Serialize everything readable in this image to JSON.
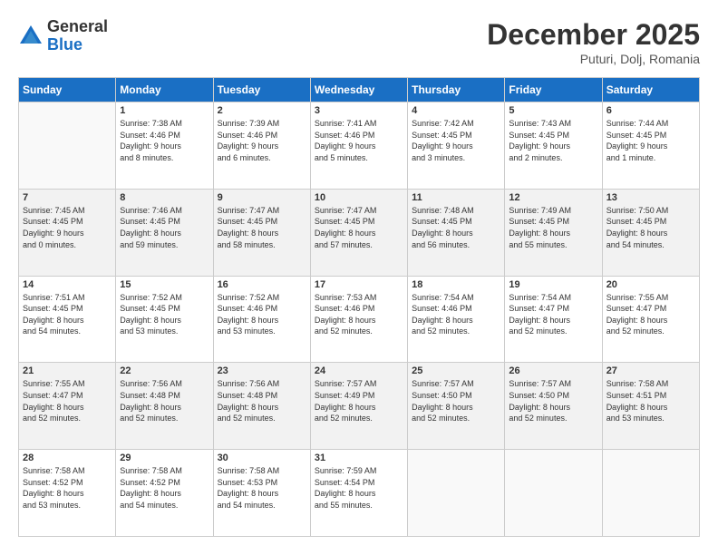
{
  "logo": {
    "general": "General",
    "blue": "Blue"
  },
  "title": "December 2025",
  "location": "Puturi, Dolj, Romania",
  "days_of_week": [
    "Sunday",
    "Monday",
    "Tuesday",
    "Wednesday",
    "Thursday",
    "Friday",
    "Saturday"
  ],
  "weeks": [
    [
      {
        "day": "",
        "info": ""
      },
      {
        "day": "1",
        "info": "Sunrise: 7:38 AM\nSunset: 4:46 PM\nDaylight: 9 hours\nand 8 minutes."
      },
      {
        "day": "2",
        "info": "Sunrise: 7:39 AM\nSunset: 4:46 PM\nDaylight: 9 hours\nand 6 minutes."
      },
      {
        "day": "3",
        "info": "Sunrise: 7:41 AM\nSunset: 4:46 PM\nDaylight: 9 hours\nand 5 minutes."
      },
      {
        "day": "4",
        "info": "Sunrise: 7:42 AM\nSunset: 4:45 PM\nDaylight: 9 hours\nand 3 minutes."
      },
      {
        "day": "5",
        "info": "Sunrise: 7:43 AM\nSunset: 4:45 PM\nDaylight: 9 hours\nand 2 minutes."
      },
      {
        "day": "6",
        "info": "Sunrise: 7:44 AM\nSunset: 4:45 PM\nDaylight: 9 hours\nand 1 minute."
      }
    ],
    [
      {
        "day": "7",
        "info": "Sunrise: 7:45 AM\nSunset: 4:45 PM\nDaylight: 9 hours\nand 0 minutes."
      },
      {
        "day": "8",
        "info": "Sunrise: 7:46 AM\nSunset: 4:45 PM\nDaylight: 8 hours\nand 59 minutes."
      },
      {
        "day": "9",
        "info": "Sunrise: 7:47 AM\nSunset: 4:45 PM\nDaylight: 8 hours\nand 58 minutes."
      },
      {
        "day": "10",
        "info": "Sunrise: 7:47 AM\nSunset: 4:45 PM\nDaylight: 8 hours\nand 57 minutes."
      },
      {
        "day": "11",
        "info": "Sunrise: 7:48 AM\nSunset: 4:45 PM\nDaylight: 8 hours\nand 56 minutes."
      },
      {
        "day": "12",
        "info": "Sunrise: 7:49 AM\nSunset: 4:45 PM\nDaylight: 8 hours\nand 55 minutes."
      },
      {
        "day": "13",
        "info": "Sunrise: 7:50 AM\nSunset: 4:45 PM\nDaylight: 8 hours\nand 54 minutes."
      }
    ],
    [
      {
        "day": "14",
        "info": "Sunrise: 7:51 AM\nSunset: 4:45 PM\nDaylight: 8 hours\nand 54 minutes."
      },
      {
        "day": "15",
        "info": "Sunrise: 7:52 AM\nSunset: 4:45 PM\nDaylight: 8 hours\nand 53 minutes."
      },
      {
        "day": "16",
        "info": "Sunrise: 7:52 AM\nSunset: 4:46 PM\nDaylight: 8 hours\nand 53 minutes."
      },
      {
        "day": "17",
        "info": "Sunrise: 7:53 AM\nSunset: 4:46 PM\nDaylight: 8 hours\nand 52 minutes."
      },
      {
        "day": "18",
        "info": "Sunrise: 7:54 AM\nSunset: 4:46 PM\nDaylight: 8 hours\nand 52 minutes."
      },
      {
        "day": "19",
        "info": "Sunrise: 7:54 AM\nSunset: 4:47 PM\nDaylight: 8 hours\nand 52 minutes."
      },
      {
        "day": "20",
        "info": "Sunrise: 7:55 AM\nSunset: 4:47 PM\nDaylight: 8 hours\nand 52 minutes."
      }
    ],
    [
      {
        "day": "21",
        "info": "Sunrise: 7:55 AM\nSunset: 4:47 PM\nDaylight: 8 hours\nand 52 minutes."
      },
      {
        "day": "22",
        "info": "Sunrise: 7:56 AM\nSunset: 4:48 PM\nDaylight: 8 hours\nand 52 minutes."
      },
      {
        "day": "23",
        "info": "Sunrise: 7:56 AM\nSunset: 4:48 PM\nDaylight: 8 hours\nand 52 minutes."
      },
      {
        "day": "24",
        "info": "Sunrise: 7:57 AM\nSunset: 4:49 PM\nDaylight: 8 hours\nand 52 minutes."
      },
      {
        "day": "25",
        "info": "Sunrise: 7:57 AM\nSunset: 4:50 PM\nDaylight: 8 hours\nand 52 minutes."
      },
      {
        "day": "26",
        "info": "Sunrise: 7:57 AM\nSunset: 4:50 PM\nDaylight: 8 hours\nand 52 minutes."
      },
      {
        "day": "27",
        "info": "Sunrise: 7:58 AM\nSunset: 4:51 PM\nDaylight: 8 hours\nand 53 minutes."
      }
    ],
    [
      {
        "day": "28",
        "info": "Sunrise: 7:58 AM\nSunset: 4:52 PM\nDaylight: 8 hours\nand 53 minutes."
      },
      {
        "day": "29",
        "info": "Sunrise: 7:58 AM\nSunset: 4:52 PM\nDaylight: 8 hours\nand 54 minutes."
      },
      {
        "day": "30",
        "info": "Sunrise: 7:58 AM\nSunset: 4:53 PM\nDaylight: 8 hours\nand 54 minutes."
      },
      {
        "day": "31",
        "info": "Sunrise: 7:59 AM\nSunset: 4:54 PM\nDaylight: 8 hours\nand 55 minutes."
      },
      {
        "day": "",
        "info": ""
      },
      {
        "day": "",
        "info": ""
      },
      {
        "day": "",
        "info": ""
      }
    ]
  ]
}
